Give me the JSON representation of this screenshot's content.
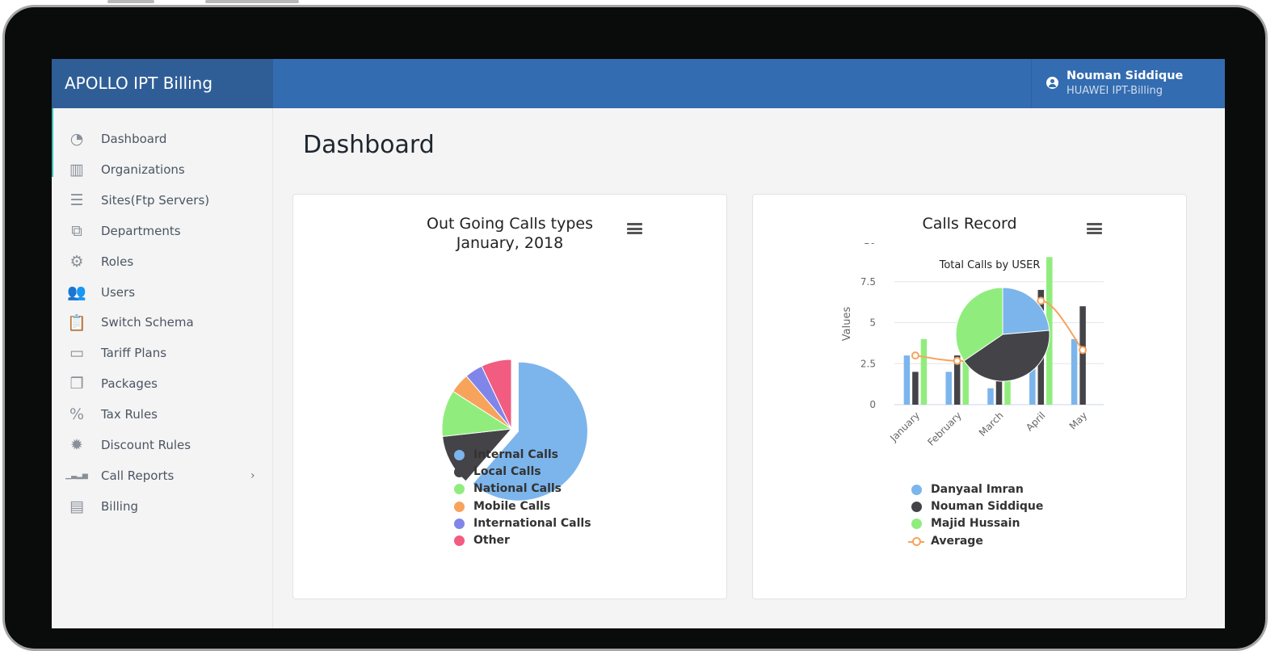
{
  "app": {
    "title": "APOLLO IPT Billing"
  },
  "user": {
    "name": "Nouman Siddique",
    "org": "HUAWEI IPT-Billing",
    "icon": "user-circle-icon"
  },
  "sidebar": {
    "items": [
      {
        "label": "Dashboard",
        "icon": "tachometer-icon",
        "glyph": "◔"
      },
      {
        "label": "Organizations",
        "icon": "building-icon",
        "glyph": "▥"
      },
      {
        "label": "Sites(Ftp Servers)",
        "icon": "server-icon",
        "glyph": "☰"
      },
      {
        "label": "Departments",
        "icon": "object-group-icon",
        "glyph": "⧉"
      },
      {
        "label": "Roles",
        "icon": "users-cog-icon",
        "glyph": "⚙"
      },
      {
        "label": "Users",
        "icon": "users-icon",
        "glyph": "👥"
      },
      {
        "label": "Switch Schema",
        "icon": "clipboard-list-icon",
        "glyph": "📋"
      },
      {
        "label": "Tariff Plans",
        "icon": "ticket-icon",
        "glyph": "▭"
      },
      {
        "label": "Packages",
        "icon": "cubes-icon",
        "glyph": "❒"
      },
      {
        "label": "Tax Rules",
        "icon": "percent-icon",
        "glyph": "%"
      },
      {
        "label": "Discount Rules",
        "icon": "certificate-icon",
        "glyph": "✹"
      },
      {
        "label": "Call Reports",
        "icon": "chart-bar-icon",
        "glyph": "▁▃▂▅",
        "chevron": "›"
      },
      {
        "label": "Billing",
        "icon": "receipt-icon",
        "glyph": "▤"
      }
    ]
  },
  "main": {
    "page_title": "Dashboard"
  },
  "colors": {
    "blue": "#7cb5ec",
    "black": "#434348",
    "green": "#90ed7d",
    "orange": "#f7a35c",
    "purple": "#8085e9",
    "pink": "#f15c80"
  },
  "chart_data": [
    {
      "type": "pie",
      "title": "Out Going Calls types",
      "subtitle": "January, 2018",
      "legend_position": "bottom",
      "slices": [
        {
          "name": "Internal Calls",
          "value": 61.41,
          "color": "#7cb5ec",
          "sliced": true
        },
        {
          "name": "Local Calls",
          "value": 11.84,
          "color": "#434348"
        },
        {
          "name": "National Calls",
          "value": 10.85,
          "color": "#90ed7d"
        },
        {
          "name": "Mobile Calls",
          "value": 4.67,
          "color": "#f7a35c"
        },
        {
          "name": "International Calls",
          "value": 4.18,
          "color": "#8085e9"
        },
        {
          "name": "Other",
          "value": 7.05,
          "color": "#f15c80"
        }
      ]
    },
    {
      "type": "bar",
      "title": "Calls Record",
      "ylabel": "Values",
      "xlabel": "",
      "ylim": [
        0,
        10
      ],
      "yticks": [
        "0",
        "2.5",
        "5",
        "7.5",
        "10"
      ],
      "grid": true,
      "legend_position": "bottom",
      "categories": [
        "January",
        "February",
        "March",
        "April",
        "May"
      ],
      "series": [
        {
          "name": "Danyaal Imran",
          "values": [
            3,
            2,
            1,
            3,
            4
          ],
          "color": "#7cb5ec"
        },
        {
          "name": "Nouman Siddique",
          "values": [
            2,
            3,
            5,
            7,
            6
          ],
          "color": "#434348"
        },
        {
          "name": "Majid Hussain",
          "values": [
            4,
            3,
            3,
            9,
            0
          ],
          "color": "#90ed7d"
        },
        {
          "name": "Average",
          "type": "spline",
          "values": [
            3,
            2.67,
            3,
            6.33,
            3.33
          ],
          "color": "#f7a35c"
        }
      ],
      "inset_pie": {
        "title": "Total Calls by USER",
        "slices": [
          {
            "name": "Danyaal Imran",
            "value": 13,
            "color": "#7cb5ec"
          },
          {
            "name": "Nouman Siddique",
            "value": 23,
            "color": "#434348"
          },
          {
            "name": "Majid Hussain",
            "value": 19,
            "color": "#90ed7d"
          }
        ]
      }
    }
  ]
}
